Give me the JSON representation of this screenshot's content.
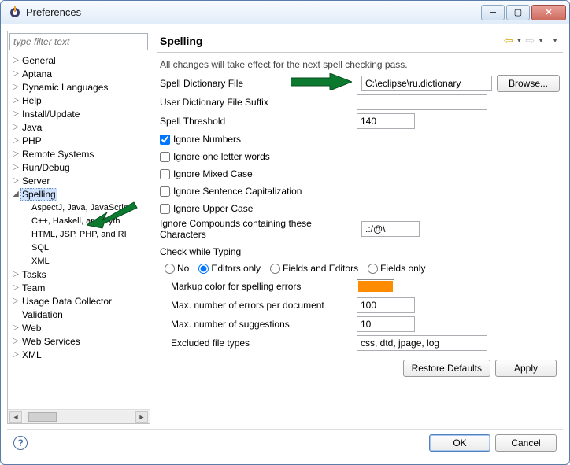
{
  "window": {
    "title": "Preferences"
  },
  "filter": {
    "placeholder": "type filter text"
  },
  "tree": {
    "items": [
      {
        "label": "General",
        "expandable": true
      },
      {
        "label": "Aptana",
        "expandable": true
      },
      {
        "label": "Dynamic Languages",
        "expandable": true
      },
      {
        "label": "Help",
        "expandable": true
      },
      {
        "label": "Install/Update",
        "expandable": true
      },
      {
        "label": "Java",
        "expandable": true
      },
      {
        "label": "PHP",
        "expandable": true
      },
      {
        "label": "Remote Systems",
        "expandable": true
      },
      {
        "label": "Run/Debug",
        "expandable": true
      },
      {
        "label": "Server",
        "expandable": true
      },
      {
        "label": "Spelling",
        "expandable": true,
        "expanded": true,
        "selected": true,
        "children": [
          {
            "label": "AspectJ, Java, JavaScript"
          },
          {
            "label": "C++, Haskell, and Pyth"
          },
          {
            "label": "HTML, JSP, PHP, and RI"
          },
          {
            "label": "SQL"
          },
          {
            "label": "XML"
          }
        ]
      },
      {
        "label": "Tasks",
        "expandable": true
      },
      {
        "label": "Team",
        "expandable": true
      },
      {
        "label": "Usage Data Collector",
        "expandable": true
      },
      {
        "label": "Validation"
      },
      {
        "label": "Web",
        "expandable": true
      },
      {
        "label": "Web Services",
        "expandable": true
      },
      {
        "label": "XML",
        "expandable": true
      }
    ]
  },
  "page": {
    "heading": "Spelling",
    "subtitle": "All changes will take effect for the next spell checking pass.",
    "labels": {
      "dictFile": "Spell Dictionary File",
      "userSuffix": "User Dictionary File Suffix",
      "threshold": "Spell Threshold",
      "ignoreNumbers": "Ignore Numbers",
      "ignoreOneLetter": "Ignore one letter words",
      "ignoreMixed": "Ignore Mixed Case",
      "ignoreSentence": "Ignore Sentence Capitalization",
      "ignoreUpper": "Ignore Upper Case",
      "ignoreCompounds": "Ignore Compounds containing these Characters",
      "checkWhileTyping": "Check while Typing",
      "markupColor": "Markup color for spelling errors",
      "maxErrors": "Max. number of errors per document",
      "maxSuggestions": "Max. number of suggestions",
      "excludedTypes": "Excluded file types"
    },
    "values": {
      "dictFile": "C:\\eclipse\\ru.dictionary",
      "userSuffix": "",
      "threshold": "140",
      "ignoreCompounds": ".:/@\\",
      "maxErrors": "100",
      "maxSuggestions": "10",
      "excludedTypes": "css, dtd, jpage, log",
      "markupColor": "#ff8c00"
    },
    "radios": {
      "no": "No",
      "editorsOnly": "Editors only",
      "fieldsAndEditors": "Fields and Editors",
      "fieldsOnly": "Fields only"
    },
    "buttons": {
      "browse": "Browse...",
      "restore": "Restore Defaults",
      "apply": "Apply",
      "ok": "OK",
      "cancel": "Cancel"
    }
  }
}
